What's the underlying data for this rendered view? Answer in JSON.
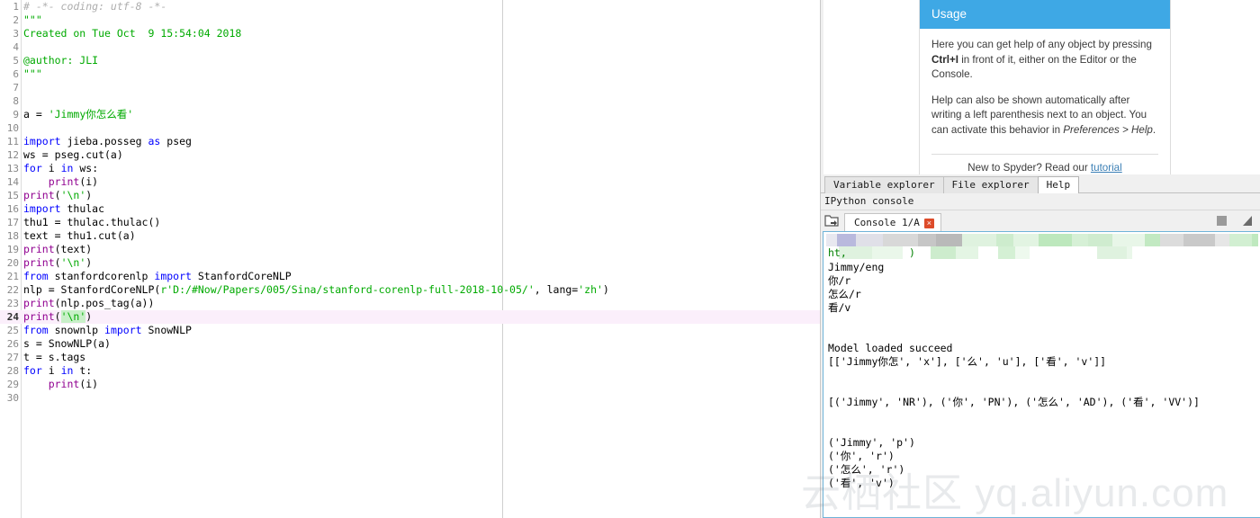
{
  "editor": {
    "current_line": 24,
    "lines": [
      {
        "n": 1,
        "tokens": [
          {
            "t": "cmt",
            "s": "# -*- coding: utf-8 -*-"
          }
        ]
      },
      {
        "n": 2,
        "tokens": [
          {
            "t": "str",
            "s": "\"\"\""
          }
        ]
      },
      {
        "n": 3,
        "tokens": [
          {
            "t": "str",
            "s": "Created on Tue Oct  9 15:54:04 2018"
          }
        ]
      },
      {
        "n": 4,
        "tokens": []
      },
      {
        "n": 5,
        "tokens": [
          {
            "t": "str",
            "s": "@author: JLI"
          }
        ]
      },
      {
        "n": 6,
        "tokens": [
          {
            "t": "str",
            "s": "\"\"\""
          }
        ]
      },
      {
        "n": 7,
        "tokens": []
      },
      {
        "n": 8,
        "tokens": []
      },
      {
        "n": 9,
        "tokens": [
          {
            "t": "txt",
            "s": "a = "
          },
          {
            "t": "str",
            "s": "'Jimmy你怎么看'"
          }
        ]
      },
      {
        "n": 10,
        "tokens": []
      },
      {
        "n": 11,
        "tokens": [
          {
            "t": "kw",
            "s": "import"
          },
          {
            "t": "txt",
            "s": " jieba.posseg "
          },
          {
            "t": "kw",
            "s": "as"
          },
          {
            "t": "txt",
            "s": " pseg"
          }
        ]
      },
      {
        "n": 12,
        "tokens": [
          {
            "t": "txt",
            "s": "ws = pseg.cut(a)"
          }
        ]
      },
      {
        "n": 13,
        "tokens": [
          {
            "t": "kw",
            "s": "for"
          },
          {
            "t": "txt",
            "s": " i "
          },
          {
            "t": "kw",
            "s": "in"
          },
          {
            "t": "txt",
            "s": " ws:"
          }
        ]
      },
      {
        "n": 14,
        "tokens": [
          {
            "t": "txt",
            "s": "    "
          },
          {
            "t": "bi",
            "s": "print"
          },
          {
            "t": "txt",
            "s": "(i)"
          }
        ]
      },
      {
        "n": 15,
        "tokens": [
          {
            "t": "bi",
            "s": "print"
          },
          {
            "t": "txt",
            "s": "("
          },
          {
            "t": "str",
            "s": "'\\n'"
          },
          {
            "t": "txt",
            "s": ")"
          }
        ]
      },
      {
        "n": 16,
        "tokens": [
          {
            "t": "kw",
            "s": "import"
          },
          {
            "t": "txt",
            "s": " thulac"
          }
        ]
      },
      {
        "n": 17,
        "tokens": [
          {
            "t": "txt",
            "s": "thu1 = thulac.thulac()"
          }
        ]
      },
      {
        "n": 18,
        "tokens": [
          {
            "t": "txt",
            "s": "text = thu1.cut(a)"
          }
        ]
      },
      {
        "n": 19,
        "tokens": [
          {
            "t": "bi",
            "s": "print"
          },
          {
            "t": "txt",
            "s": "(text)"
          }
        ]
      },
      {
        "n": 20,
        "tokens": [
          {
            "t": "bi",
            "s": "print"
          },
          {
            "t": "txt",
            "s": "("
          },
          {
            "t": "str",
            "s": "'\\n'"
          },
          {
            "t": "txt",
            "s": ")"
          }
        ]
      },
      {
        "n": 21,
        "tokens": [
          {
            "t": "kw",
            "s": "from"
          },
          {
            "t": "txt",
            "s": " stanfordcorenlp "
          },
          {
            "t": "kw",
            "s": "import"
          },
          {
            "t": "txt",
            "s": " StanfordCoreNLP"
          }
        ]
      },
      {
        "n": 22,
        "tokens": [
          {
            "t": "txt",
            "s": "nlp = StanfordCoreNLP("
          },
          {
            "t": "str",
            "s": "r'D:/#Now/Papers/005/Sina/stanford-corenlp-full-2018-10-05/'"
          },
          {
            "t": "txt",
            "s": ", lang="
          },
          {
            "t": "str",
            "s": "'zh'"
          },
          {
            "t": "txt",
            "s": ")"
          }
        ]
      },
      {
        "n": 23,
        "tokens": [
          {
            "t": "bi",
            "s": "print"
          },
          {
            "t": "txt",
            "s": "(nlp.pos_tag(a))"
          }
        ]
      },
      {
        "n": 24,
        "tokens": [
          {
            "t": "bi",
            "s": "print"
          },
          {
            "t": "txt",
            "s": "("
          },
          {
            "t": "str",
            "s": "'\\n'"
          },
          {
            "t": "txt",
            "s": ")"
          }
        ]
      },
      {
        "n": 25,
        "tokens": [
          {
            "t": "kw",
            "s": "from"
          },
          {
            "t": "txt",
            "s": " snownlp "
          },
          {
            "t": "kw",
            "s": "import"
          },
          {
            "t": "txt",
            "s": " SnowNLP"
          }
        ]
      },
      {
        "n": 26,
        "tokens": [
          {
            "t": "txt",
            "s": "s = SnowNLP(a)"
          }
        ]
      },
      {
        "n": 27,
        "tokens": [
          {
            "t": "txt",
            "s": "t = s.tags"
          }
        ]
      },
      {
        "n": 28,
        "tokens": [
          {
            "t": "kw",
            "s": "for"
          },
          {
            "t": "txt",
            "s": " i "
          },
          {
            "t": "kw",
            "s": "in"
          },
          {
            "t": "txt",
            "s": " t:"
          }
        ]
      },
      {
        "n": 29,
        "tokens": [
          {
            "t": "txt",
            "s": "    "
          },
          {
            "t": "bi",
            "s": "print"
          },
          {
            "t": "txt",
            "s": "(i)"
          }
        ]
      },
      {
        "n": 30,
        "tokens": []
      }
    ]
  },
  "help": {
    "card_title": "Usage",
    "para1_a": "Here you can get help of any object by pressing ",
    "para1_b": "Ctrl+I",
    "para1_c": " in front of it, either on the Editor or the Console.",
    "para2_a": "Help can also be shown automatically after writing a left parenthesis next to an object. You can activate this behavior in ",
    "para2_b": "Preferences > Help",
    "para2_c": ".",
    "footer_text": "New to Spyder? Read our ",
    "footer_link": "tutorial"
  },
  "panel_tabs": [
    {
      "label": "Variable explorer",
      "active": false
    },
    {
      "label": "File explorer",
      "active": false
    },
    {
      "label": "Help",
      "active": true
    }
  ],
  "console": {
    "pane_title": "IPython console",
    "tab_label": "Console 1/A",
    "tab_close_glyph": "×",
    "folder_icon": "folder-icon",
    "redacted_partial_line": "ht,          )",
    "output_lines": [
      "Jimmy/eng",
      "你/r",
      "怎么/r",
      "看/v",
      "",
      "",
      "Model loaded succeed",
      "[['Jimmy你怎', 'x'], ['么', 'u'], ['看', 'v']]",
      "",
      "",
      "[('Jimmy', 'NR'), ('你', 'PN'), ('怎么', 'AD'), ('看', 'VV')]",
      "",
      "",
      "('Jimmy', 'p')",
      "('你', 'r')",
      "('怎么', 'r')",
      "('看', 'v')"
    ]
  },
  "watermark": {
    "text": "云栖社区 yq.aliyun.com"
  },
  "colors": {
    "accent_blue": "#3ea8e5",
    "string_green": "#00aa00",
    "keyword_blue": "#0000ff",
    "builtin_purple": "#900090",
    "comment_grey": "#adadad",
    "current_line": "#fbeffb",
    "close_red": "#dd4b2a"
  }
}
